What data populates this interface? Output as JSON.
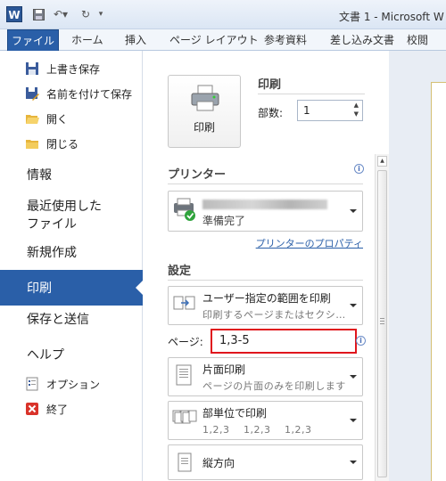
{
  "titlebar": {
    "app_letter": "W",
    "title": "文書 1 - Microsoft W"
  },
  "ribbon": {
    "tabs": [
      "ファイル",
      "ホーム",
      "挿入",
      "ページ レイアウト",
      "参考資料",
      "差し込み文書",
      "校閲"
    ]
  },
  "sidebar": {
    "save": "上書き保存",
    "save_as": "名前を付けて保存",
    "open": "開く",
    "close": "閉じる",
    "info": "情報",
    "recent_line1": "最近使用した",
    "recent_line2": "ファイル",
    "new": "新規作成",
    "print": "印刷",
    "save_send": "保存と送信",
    "help": "ヘルプ",
    "options": "オプション",
    "exit": "終了"
  },
  "print": {
    "heading": "印刷",
    "button_label": "印刷",
    "copies_label": "部数:",
    "copies_value": "1",
    "printer_heading": "プリンター",
    "printer_status": "準備完了",
    "printer_properties": "プリンターのプロパティ",
    "settings_heading": "設定",
    "range_title": "ユーザー指定の範囲を印刷",
    "range_desc": "印刷するページまたはセクシ…",
    "pages_label": "ページ:",
    "pages_value": "1,3-5",
    "sides_title": "片面印刷",
    "sides_desc": "ページの片面のみを印刷します",
    "collate_title": "部単位で印刷",
    "collate_desc": "1,2,3　 1,2,3　 1,2,3",
    "orientation_title": "縦方向"
  },
  "colors": {
    "accent": "#2a5fa8",
    "highlight": "#e0161d"
  }
}
